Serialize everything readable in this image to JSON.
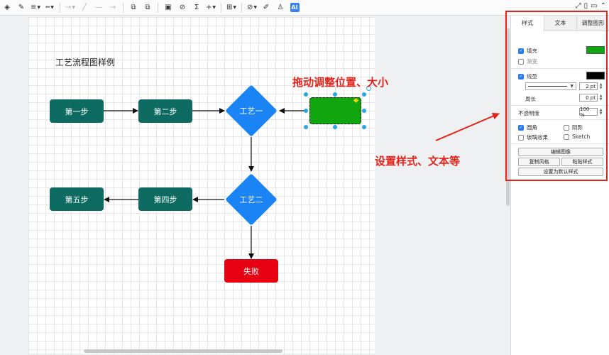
{
  "toolbar": {
    "tools": [
      {
        "name": "fill-color-icon",
        "glyph": "◈"
      },
      {
        "name": "line-color-icon",
        "glyph": "✎"
      },
      {
        "name": "line-width-icon",
        "glyph": "≡"
      },
      {
        "name": "line-style-icon",
        "glyph": "┅"
      },
      {
        "name": "connector-icon",
        "glyph": "→"
      },
      {
        "name": "line-draw-icon",
        "glyph": "╱"
      },
      {
        "name": "dash-icon",
        "glyph": "—"
      },
      {
        "name": "arrow-end-icon",
        "glyph": "→"
      },
      {
        "name": "bring-front-icon",
        "glyph": "⧉"
      },
      {
        "name": "send-back-icon",
        "glyph": "⧉"
      },
      {
        "name": "image-icon",
        "glyph": "▣"
      },
      {
        "name": "link-icon",
        "glyph": "⊘"
      },
      {
        "name": "formula-icon",
        "glyph": "Σ"
      },
      {
        "name": "insert-icon",
        "glyph": "+"
      },
      {
        "name": "table-icon",
        "glyph": "⊞"
      },
      {
        "name": "format-icon",
        "glyph": "⊘"
      },
      {
        "name": "pen-icon",
        "glyph": "✐"
      },
      {
        "name": "shirt-icon",
        "glyph": "♙"
      },
      {
        "name": "ai-icon",
        "glyph": "AI"
      }
    ],
    "right_icons": [
      "⤢",
      "▯",
      "▭",
      "⌃"
    ]
  },
  "diagram": {
    "title": "工艺流程图样例",
    "nodes": {
      "step1": "第一步",
      "step2": "第二步",
      "process1": "工艺一",
      "process2": "工艺二",
      "step4": "第四步",
      "step5": "第五步",
      "fail": "失败"
    },
    "colors": {
      "step": "#0e6b61",
      "diamond": "#1a84f5",
      "fail": "#e60012",
      "selected_fill": "#11a50f",
      "annotation": "#e2231a"
    }
  },
  "annotations": {
    "drag_hint": "拖动调整位置、大小",
    "style_hint": "设置样式、文本等"
  },
  "panel": {
    "tabs": [
      "样式",
      "文本",
      "调整图形"
    ],
    "active_tab": "样式",
    "fill": {
      "label": "填充",
      "checked": true,
      "color": "#11a50f"
    },
    "gradient": {
      "label": "渐变",
      "checked": false
    },
    "line": {
      "label": "线型",
      "checked": true,
      "color": "#000000"
    },
    "line_width": "2 pt",
    "perimeter": {
      "label": "周长",
      "value": "0 pt"
    },
    "opacity": {
      "label": "不透明度",
      "value": "100 %"
    },
    "rounded": {
      "label": "圆角",
      "checked": true
    },
    "shadow": {
      "label": "阴影",
      "checked": false
    },
    "glass": {
      "label": "玻璃效果",
      "checked": false
    },
    "sketch": {
      "label": "Sketch",
      "checked": false
    },
    "buttons": {
      "edit_image": "编辑图像",
      "copy_style": "复制风格",
      "paste_style": "粘贴样式",
      "set_default": "设置为默认样式"
    }
  }
}
